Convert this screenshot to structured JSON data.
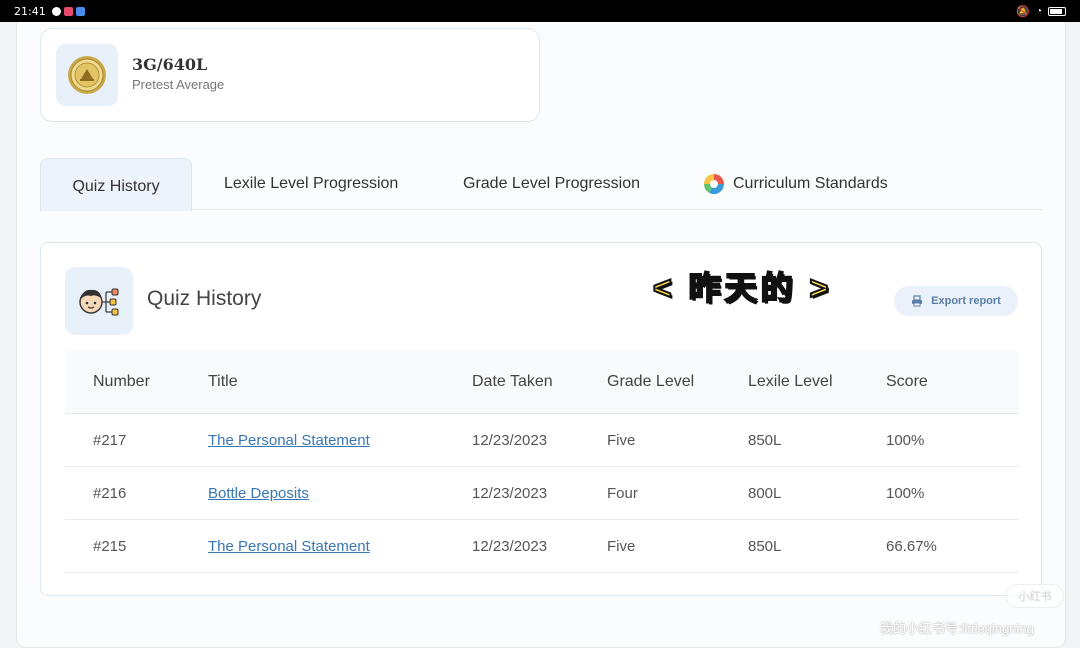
{
  "statusbar": {
    "time": "21:41"
  },
  "stat": {
    "value": "3G/640L",
    "label": "Pretest Average"
  },
  "tabs": [
    {
      "label": "Quiz History",
      "active": true
    },
    {
      "label": "Lexile Level Progression",
      "active": false
    },
    {
      "label": "Grade Level Progression",
      "active": false
    },
    {
      "label": "Curriculum Standards",
      "active": false
    }
  ],
  "section": {
    "title": "Quiz History",
    "export_label": "Export report"
  },
  "overlay": {
    "text": "< 昨天的 >"
  },
  "table": {
    "headers": [
      "Number",
      "Title",
      "Date Taken",
      "Grade Level",
      "Lexile Level",
      "Score"
    ],
    "rows": [
      [
        "#217",
        "The Personal Statement",
        "12/23/2023",
        "Five",
        "850L",
        "100%"
      ],
      [
        "#216",
        "Bottle Deposits",
        "12/23/2023",
        "Four",
        "800L",
        "100%"
      ],
      [
        "#215",
        "The Personal Statement",
        "12/23/2023",
        "Five",
        "850L",
        "66.67%"
      ]
    ]
  },
  "watermark": {
    "logo": "小红书",
    "text": "我的小红书号:littleqingning"
  },
  "colors": {
    "link": "#3a76b3",
    "tab_active_bg": "#edf3fa",
    "icon_bg": "#e8f0fa",
    "overlay": "#ffe14d"
  }
}
